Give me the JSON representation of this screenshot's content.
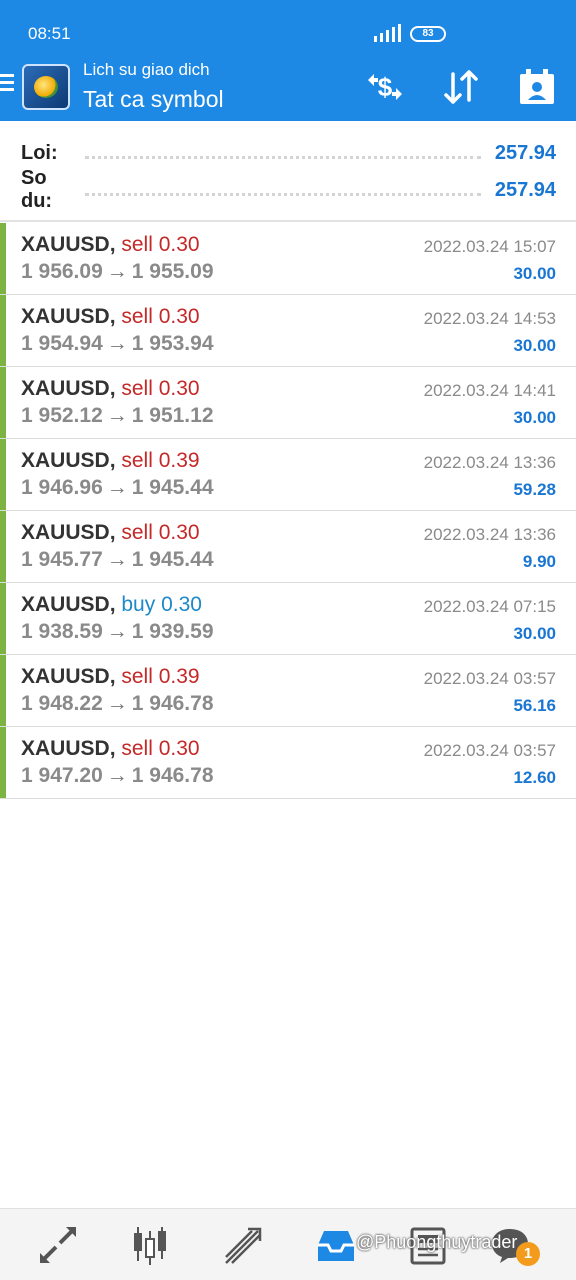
{
  "status_bar": {
    "time": "08:51",
    "battery": "83"
  },
  "header": {
    "subtitle": "Lich su giao dich",
    "title": "Tat ca symbol",
    "icons": [
      "hamburger-menu-icon",
      "metatrader-logo",
      "deposit-withdraw-icon",
      "sort-icon",
      "calendar-period-icon"
    ]
  },
  "summary": {
    "profit_label": "Loi:",
    "profit_value": "257.94",
    "balance_label": "So du:",
    "balance_value": "257.94"
  },
  "deals": [
    {
      "symbol": "XAUUSD",
      "sep": ",",
      "action": "sell",
      "volume": "0.30",
      "open": "1 956.09",
      "arrow": "→",
      "close": "1 955.09",
      "time": "2022.03.24 15:07",
      "profit": "30.00"
    },
    {
      "symbol": "XAUUSD",
      "sep": ",",
      "action": "sell",
      "volume": "0.30",
      "open": "1 954.94",
      "arrow": "→",
      "close": "1 953.94",
      "time": "2022.03.24 14:53",
      "profit": "30.00"
    },
    {
      "symbol": "XAUUSD",
      "sep": ",",
      "action": "sell",
      "volume": "0.30",
      "open": "1 952.12",
      "arrow": "→",
      "close": "1 951.12",
      "time": "2022.03.24 14:41",
      "profit": "30.00"
    },
    {
      "symbol": "XAUUSD",
      "sep": ",",
      "action": "sell",
      "volume": "0.39",
      "open": "1 946.96",
      "arrow": "→",
      "close": "1 945.44",
      "time": "2022.03.24 13:36",
      "profit": "59.28"
    },
    {
      "symbol": "XAUUSD",
      "sep": ",",
      "action": "sell",
      "volume": "0.30",
      "open": "1 945.77",
      "arrow": "→",
      "close": "1 945.44",
      "time": "2022.03.24 13:36",
      "profit": "9.90"
    },
    {
      "symbol": "XAUUSD",
      "sep": ",",
      "action": "buy",
      "volume": "0.30",
      "open": "1 938.59",
      "arrow": "→",
      "close": "1 939.59",
      "time": "2022.03.24 07:15",
      "profit": "30.00"
    },
    {
      "symbol": "XAUUSD",
      "sep": ",",
      "action": "sell",
      "volume": "0.39",
      "open": "1 948.22",
      "arrow": "→",
      "close": "1 946.78",
      "time": "2022.03.24 03:57",
      "profit": "56.16"
    },
    {
      "symbol": "XAUUSD",
      "sep": ",",
      "action": "sell",
      "volume": "0.30",
      "open": "1 947.20",
      "arrow": "→",
      "close": "1 946.78",
      "time": "2022.03.24 03:57",
      "profit": "12.60"
    }
  ],
  "bottom_nav": {
    "items": [
      "quotes-icon",
      "chart-icon",
      "trade-icon",
      "history-icon",
      "news-icon",
      "chat-icon"
    ],
    "active": "history-icon",
    "notification_count": "1"
  },
  "watermark": "@Phuongthuytrader",
  "colors": {
    "primary": "#1e88e5",
    "sell": "#c62828",
    "buy": "#1e88c8",
    "profit": "#1976d2",
    "accent_bar": "#7cb342"
  }
}
